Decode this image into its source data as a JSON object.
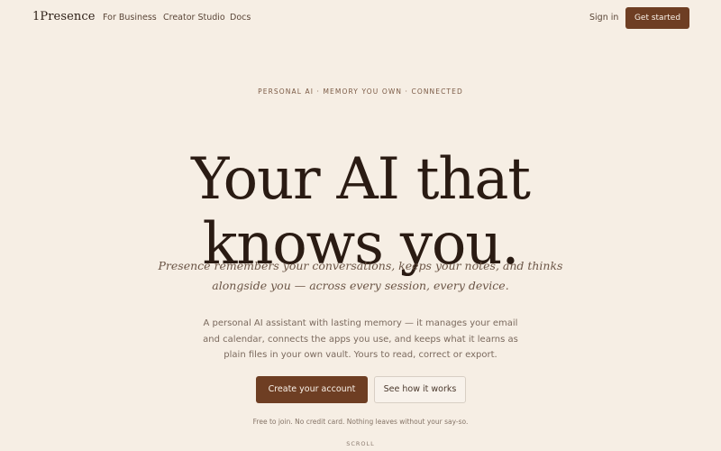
{
  "nav": {
    "logo": "1Presence",
    "links": [
      "For Business",
      "Creator Studio",
      "Docs"
    ],
    "sign_in": "Sign in",
    "cta": "Get started"
  },
  "hero": {
    "eyebrow": "PERSONAL AI · MEMORY YOU OWN · CONNECTED",
    "headline_line1": "Your AI that",
    "headline_line2": "knows you.",
    "subhead_line1": "Presence remembers your conversations, keeps your notes, and thinks",
    "subhead_line2": "alongside you — across every session, every device.",
    "body": "A personal AI assistant with lasting memory — it manages your email and calendar, connects the apps you use, and keeps what it learns as plain files in your own vault. Yours to read, correct or export.",
    "primary_button": "Create your account",
    "secondary_button": "See how it works",
    "fineprint": "Free to join. No credit card. Nothing leaves without your say-so.",
    "scroll": "SCROLL"
  },
  "colors": {
    "background": "#f6eee4",
    "accent": "#6e3e23",
    "heading": "#2a1b13"
  }
}
